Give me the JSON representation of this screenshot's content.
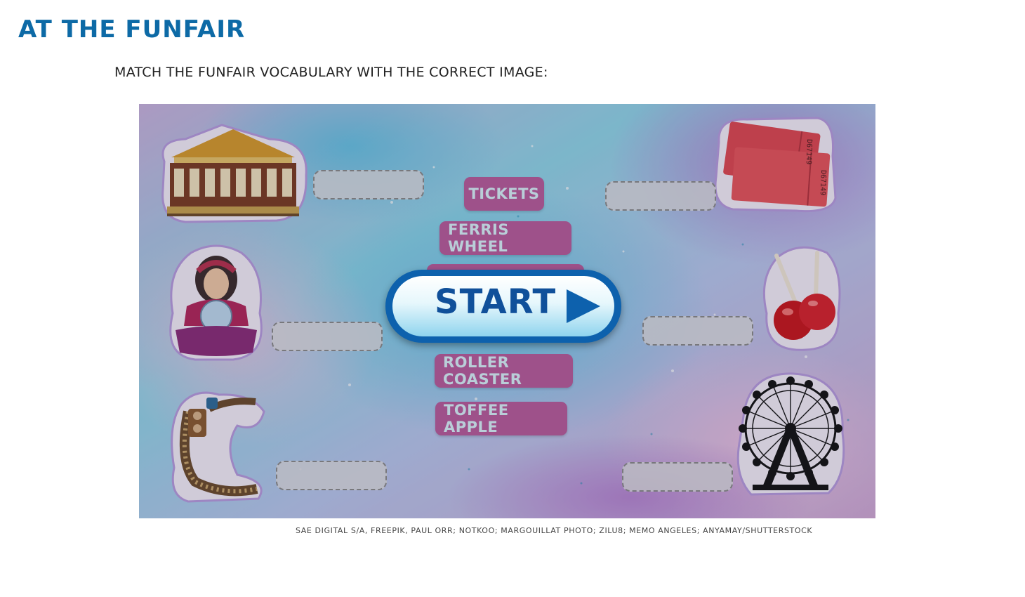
{
  "page": {
    "title": "AT THE FUNFAIR",
    "instructions": "MATCH THE FUNFAIR VOCABULARY WITH THE CORRECT IMAGE:",
    "credits": "SAE DIGITAL S/A, FREEPIK, PAUL ORR; NOTKOO; MARGOUILLAT PHOTO; ZILU8; MEMO ANGELES; ANYAMAY/SHUTTERSTOCK"
  },
  "activity": {
    "start_label": "START",
    "word_tiles": [
      {
        "label": "TICKETS"
      },
      {
        "label": "FERRIS WHEEL"
      },
      {
        "label": ""
      },
      {
        "label": "ROLLER COASTER"
      },
      {
        "label": "TOFFEE APPLE"
      }
    ],
    "pictures": [
      "carousel-picture",
      "fortune-teller-picture",
      "roller-coaster-picture",
      "tickets-picture",
      "toffee-apple-picture",
      "ferris-wheel-picture"
    ],
    "ticket_numbers": [
      "D67149",
      "D67149"
    ]
  },
  "colors": {
    "title": "#0d6aa6",
    "tile_bg": "#b95b9c",
    "tile_text": "#d9f3fa",
    "start_border": "#0d61ad",
    "start_text": "#10509a"
  }
}
